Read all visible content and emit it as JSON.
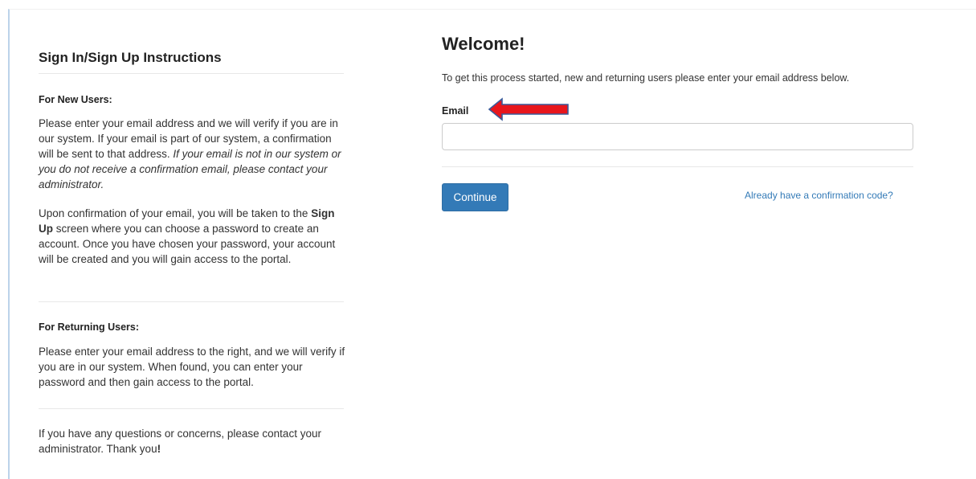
{
  "instructions": {
    "title": "Sign In/Sign Up Instructions",
    "new_users": {
      "heading": "For New Users:",
      "p1_text": "Please enter your email address and we will verify if you are in our system. If your email is part of our system, a confirmation will be sent to that address. ",
      "p1_italic": "If your email is not in our system or you do not receive a confirmation email, please contact your administrator.",
      "p2_before": "Upon confirmation of your email, you will be taken to the ",
      "p2_bold": "Sign Up",
      "p2_after": " screen where you can choose a password to create an account. Once you have chosen your password, your account will be created and you will gain access to the portal."
    },
    "returning_users": {
      "heading": "For Returning Users:",
      "text": "Please enter your email address to the right, and we will verify if you are in our system. When found, you can enter your password and then gain access to the portal."
    },
    "footer": {
      "before": "If you have any questions or concerns, please contact your administrator. Thank you",
      "bold": "!"
    }
  },
  "welcome": {
    "title": "Welcome!",
    "description": "To get this process started, new and returning users please enter your email address below.",
    "email_label": "Email",
    "email_value": "",
    "continue_label": "Continue",
    "confirmation_link": "Already have a confirmation code?"
  },
  "colors": {
    "primary": "#337ab7",
    "arrow_fill": "#e8161c",
    "arrow_outline": "#3a5a9a"
  }
}
